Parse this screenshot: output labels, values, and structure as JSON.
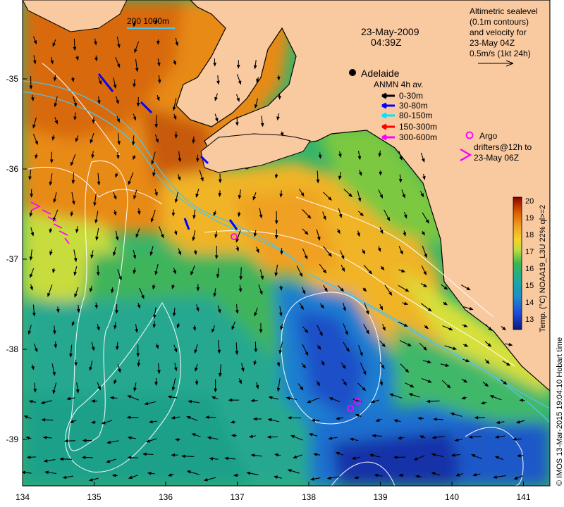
{
  "map": {
    "date": "23-May-2009",
    "time": "04:39Z",
    "scale_bar_label": "200  1000m",
    "city": "Adelaide",
    "x_ticks": [
      "134",
      "135",
      "136",
      "137",
      "138",
      "139",
      "140",
      "141"
    ],
    "y_ticks": [
      "-35",
      "-36",
      "-37",
      "-38",
      "-39"
    ],
    "sealevel_note": [
      "Altimetric sealevel",
      "(0.1m contours)",
      "and velocity for",
      "23-May 04Z",
      "0.5m/s (1kt 24h)"
    ],
    "anmn": {
      "title": "ANMN 4h av.",
      "entries": [
        {
          "label": "0-30m",
          "color": "#000000"
        },
        {
          "label": "30-80m",
          "color": "#0000ff"
        },
        {
          "label": "80-150m",
          "color": "#00e5ff"
        },
        {
          "label": "150-300m",
          "color": "#ff0000"
        },
        {
          "label": "300-600m",
          "color": "#ff00ff"
        }
      ]
    },
    "argo": {
      "label": "Argo",
      "note": [
        "drifters@12h to",
        "23-May 06Z"
      ],
      "color": "#ff00ff"
    },
    "colorbar": {
      "ticks": [
        "20",
        "19",
        "18",
        "17",
        "16",
        "15",
        "14",
        "13"
      ],
      "label": "Temp. (°C) NOAA19_L3U 22% ql>=2",
      "colors": [
        "#8b0000",
        "#c43000",
        "#e86a00",
        "#f0a020",
        "#f4d22a",
        "#d6e43a",
        "#86d048",
        "#34b45a",
        "#1aa890",
        "#1e8ec8",
        "#1e5cd8",
        "#1424a0"
      ]
    },
    "credit": "© IMOS 13-Mar-2015 19:04:10 Hobart time",
    "palette": {
      "land": "#f9c9a0",
      "coast": "#000000",
      "contour": "#ffffff",
      "isobath": "#4fc4e8"
    }
  }
}
